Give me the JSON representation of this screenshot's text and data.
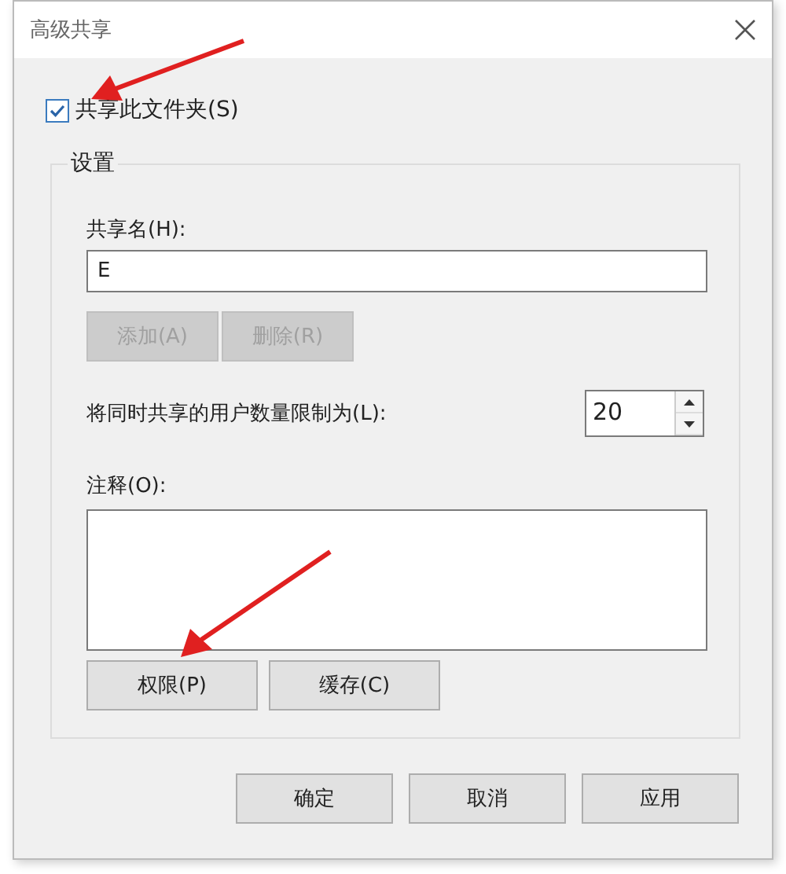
{
  "window": {
    "title": "高级共享"
  },
  "share_checkbox": {
    "label": "共享此文件夹(S)",
    "checked": true
  },
  "settings": {
    "title": "设置",
    "share_name_label": "共享名(H):",
    "share_name": "E",
    "name_buttons": [
      {
        "label": "添加(A)",
        "disabled": true
      },
      {
        "label": "删除(R)",
        "disabled": true
      }
    ],
    "limit_label": "将同时共享的用户数量限制为(L):",
    "limit_value": "20",
    "comment_label": "注释(O):",
    "buttons": [
      {
        "label": "权限(P)",
        "disabled": false
      },
      {
        "label": "缓存(C)",
        "disabled": false
      }
    ]
  },
  "footer_buttons": [
    {
      "label": "确定"
    },
    {
      "label": "取消"
    },
    {
      "label": "应用"
    }
  ]
}
